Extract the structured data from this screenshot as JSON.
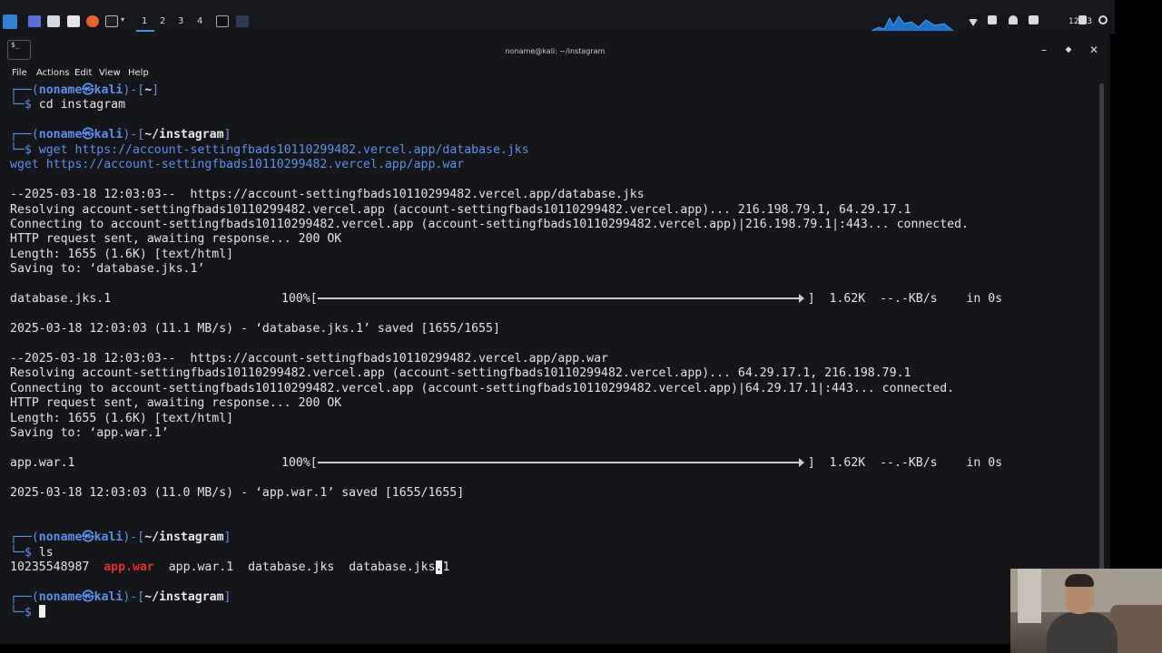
{
  "taskbar": {
    "workspaces": [
      "1",
      "2",
      "3",
      "4"
    ],
    "clock": "12:03"
  },
  "window": {
    "title": "noname@kali: ~/instagram",
    "menu": [
      "File",
      "Actions",
      "Edit",
      "View",
      "Help"
    ]
  },
  "prompt": {
    "user": "noname",
    "host": "kali"
  },
  "terminal": {
    "p1_path": "~",
    "cmd1": "cd instagram",
    "p2_path": "~/instagram",
    "cmd2a": "wget https://account-settingfbads10110299482.vercel.app/database.jks",
    "cmd2b": "wget https://account-settingfbads10110299482.vercel.app/app.war",
    "d1_start": "--2025-03-18 12:03:03--  https://account-settingfbads10110299482.vercel.app/database.jks",
    "d1_resolve": "Resolving account-settingfbads10110299482.vercel.app (account-settingfbads10110299482.vercel.app)... 216.198.79.1, 64.29.17.1",
    "d1_connect": "Connecting to account-settingfbads10110299482.vercel.app (account-settingfbads10110299482.vercel.app)|216.198.79.1|:443... connected.",
    "d1_http": "HTTP request sent, awaiting response... 200 OK",
    "d1_length": "Length: 1655 (1.6K) [text/html]",
    "d1_saving": "Saving to: ‘database.jks.1’",
    "d1_file": "database.jks.1",
    "d1_pct": "100%[",
    "d1_stats": "]  1.62K  --.-KB/s    in 0s",
    "d1_saved": "2025-03-18 12:03:03 (11.1 MB/s) - ‘database.jks.1’ saved [1655/1655]",
    "d2_start": "--2025-03-18 12:03:03--  https://account-settingfbads10110299482.vercel.app/app.war",
    "d2_resolve": "Resolving account-settingfbads10110299482.vercel.app (account-settingfbads10110299482.vercel.app)... 64.29.17.1, 216.198.79.1",
    "d2_connect": "Connecting to account-settingfbads10110299482.vercel.app (account-settingfbads10110299482.vercel.app)|64.29.17.1|:443... connected.",
    "d2_http": "HTTP request sent, awaiting response... 200 OK",
    "d2_length": "Length: 1655 (1.6K) [text/html]",
    "d2_saving": "Saving to: ‘app.war.1’",
    "d2_file": "app.war.1",
    "d2_pct": "100%[",
    "d2_stats": "]  1.62K  --.-KB/s    in 0s",
    "d2_saved": "2025-03-18 12:03:03 (11.0 MB/s) - ‘app.war.1’ saved [1655/1655]",
    "p3_path": "~/instagram",
    "cmd3": "ls",
    "ls_1": "10235548987",
    "ls_2": "app.war",
    "ls_3": "app.war.1",
    "ls_4": "database.jks",
    "ls_5a": "database.jks",
    "ls_5b": ".",
    "ls_5c": "1",
    "p4_path": "~/instagram"
  }
}
